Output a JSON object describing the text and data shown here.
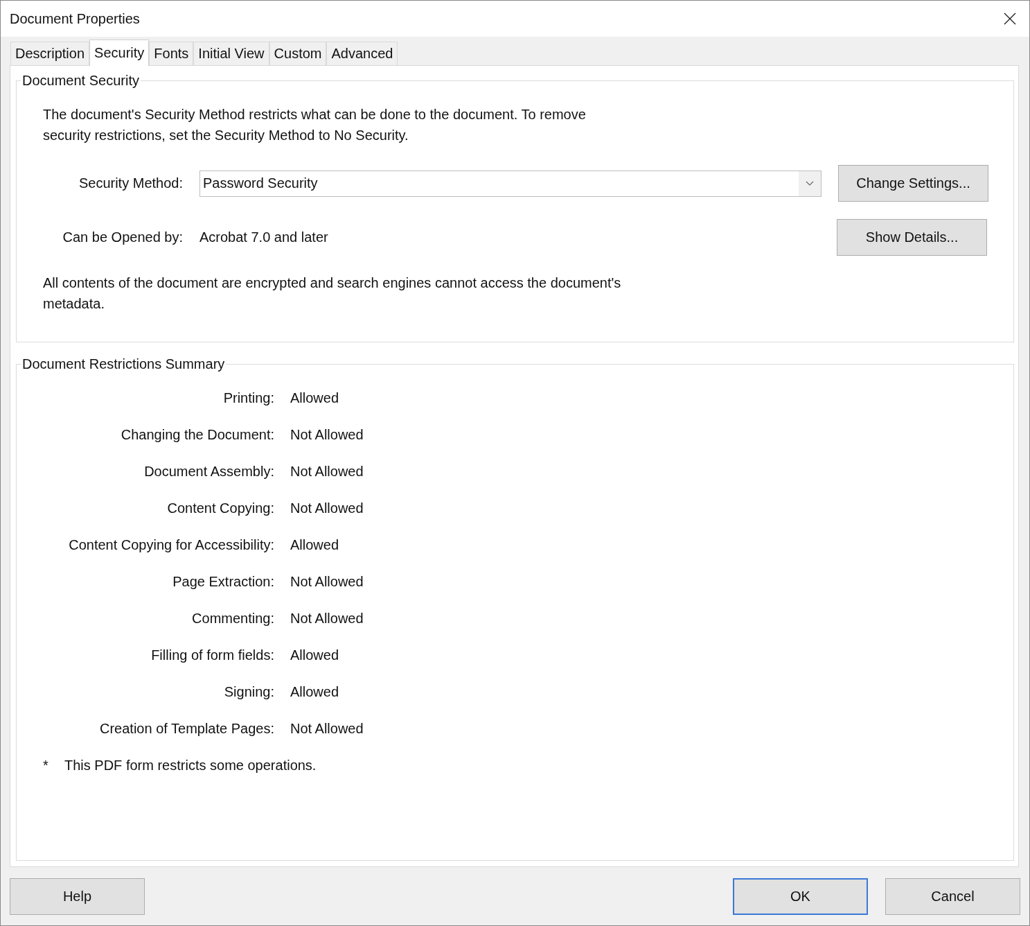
{
  "window": {
    "title": "Document Properties"
  },
  "tabs": [
    {
      "label": "Description",
      "selected": false
    },
    {
      "label": "Security",
      "selected": true
    },
    {
      "label": "Fonts",
      "selected": false
    },
    {
      "label": "Initial View",
      "selected": false
    },
    {
      "label": "Custom",
      "selected": false
    },
    {
      "label": "Advanced",
      "selected": false
    }
  ],
  "document_security": {
    "title": "Document Security",
    "intro": "The document's Security Method restricts what can be done to the document. To remove security restrictions, set the Security Method to No Security.",
    "method_label": "Security Method:",
    "method_value": "Password Security",
    "change_button": "Change Settings...",
    "opened_label": "Can be Opened by:",
    "opened_value": "Acrobat 7.0 and later",
    "details_button": "Show Details...",
    "note": "All contents of the document are encrypted and search engines cannot access the document's metadata."
  },
  "restrictions": {
    "title": "Document Restrictions Summary",
    "rows": [
      {
        "label": "Printing:",
        "value": "Allowed"
      },
      {
        "label": "Changing the Document:",
        "value": "Not Allowed"
      },
      {
        "label": "Document Assembly:",
        "value": "Not Allowed"
      },
      {
        "label": "Content Copying:",
        "value": "Not Allowed"
      },
      {
        "label": "Content Copying for Accessibility:",
        "value": "Allowed"
      },
      {
        "label": "Page Extraction:",
        "value": "Not Allowed"
      },
      {
        "label": "Commenting:",
        "value": "Not Allowed"
      },
      {
        "label": "Filling of form fields:",
        "value": "Allowed"
      },
      {
        "label": "Signing:",
        "value": "Allowed"
      },
      {
        "label": "Creation of Template Pages:",
        "value": "Not Allowed"
      }
    ],
    "footnote_mark": "*",
    "footnote": "This PDF form restricts some operations."
  },
  "footer": {
    "left_buttons": [
      {
        "label": "Help",
        "default": false
      }
    ],
    "right_buttons": [
      {
        "label": "OK",
        "default": true
      },
      {
        "label": "Cancel",
        "default": false
      }
    ]
  }
}
